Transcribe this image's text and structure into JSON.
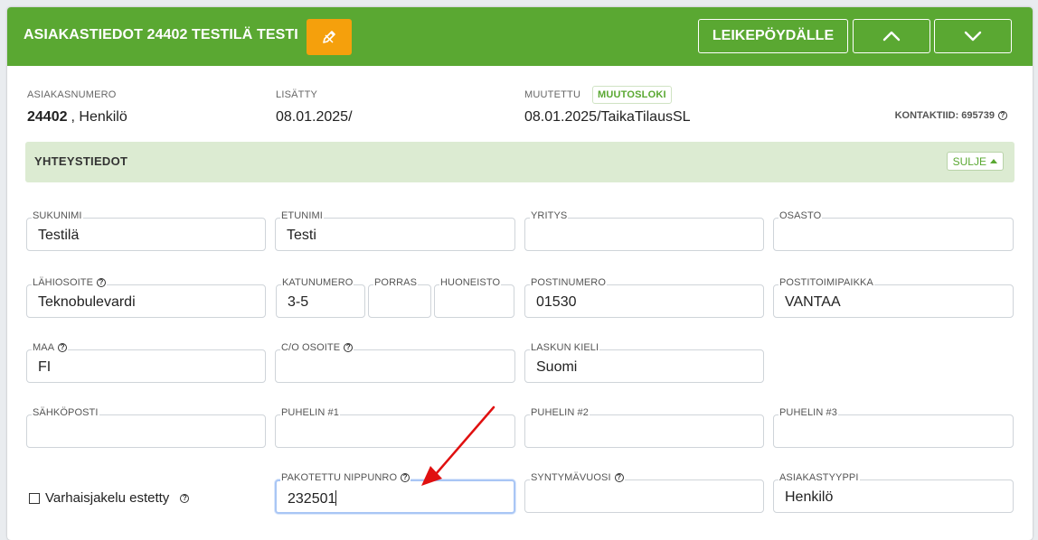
{
  "header": {
    "title": "ASIAKASTIEDOT 24402 TESTILÄ TESTI",
    "clipboard_label": "LEIKEPÖYDÄLLE",
    "edit_icon": "pencil-icon",
    "up_icon": "chevron-up-icon",
    "down_icon": "chevron-down-icon",
    "color": "#5aa832",
    "edit_color": "#f5a00c"
  },
  "meta": {
    "customer_number_label": "ASIAKASNUMERO",
    "customer_number": "24402",
    "customer_type_suffix": ", Henkilö",
    "added_label": "LISÄTTY",
    "added_value": "08.01.2025/",
    "modified_label": "MUUTETTU",
    "change_log_label": "MUUTOSLOKI",
    "modified_value": "08.01.2025/TaikaTilausSL",
    "contact_id": "KONTAKTIID: 695739"
  },
  "section": {
    "title": "YHTEYSTIEDOT",
    "close_label": "SULJE"
  },
  "fields": {
    "sukunimi": {
      "label": "SUKUNIMI",
      "value": "Testilä"
    },
    "etunimi": {
      "label": "ETUNIMI",
      "value": "Testi"
    },
    "yritys": {
      "label": "YRITYS",
      "value": ""
    },
    "osasto": {
      "label": "OSASTO",
      "value": ""
    },
    "lahiosoite": {
      "label": "LÄHIOSOITE",
      "value": "Teknobulevardi"
    },
    "katunumero": {
      "label": "KATUNUMERO",
      "value": "3-5"
    },
    "porras": {
      "label": "PORRAS",
      "value": ""
    },
    "huoneisto": {
      "label": "HUONEISTO",
      "value": ""
    },
    "postinumero": {
      "label": "POSTINUMERO",
      "value": "01530"
    },
    "postitoimipaikka": {
      "label": "POSTITOIMIPAIKKA",
      "value": "VANTAA"
    },
    "maa": {
      "label": "MAA",
      "value": "FI"
    },
    "co_osoite": {
      "label": "C/O OSOITE",
      "value": ""
    },
    "laskun_kieli": {
      "label": "LASKUN KIELI",
      "value": "Suomi"
    },
    "sahkoposti": {
      "label": "SÄHKÖPOSTI",
      "value": ""
    },
    "puhelin1": {
      "label": "PUHELIN #1",
      "value": ""
    },
    "puhelin2": {
      "label": "PUHELIN #2",
      "value": ""
    },
    "puhelin3": {
      "label": "PUHELIN #3",
      "value": ""
    },
    "nippunro": {
      "label": "PAKOTETTU NIPPUNRO",
      "value": "232501"
    },
    "syntymavuosi": {
      "label": "SYNTYMÄVUOSI",
      "value": ""
    },
    "asiakastyyppi": {
      "label": "ASIAKASTYYPPI",
      "value": "Henkilö"
    }
  },
  "checkbox": {
    "label": "Varhaisjakelu estetty",
    "checked": false
  },
  "annotation": {
    "arrow_color": "#e01010"
  }
}
